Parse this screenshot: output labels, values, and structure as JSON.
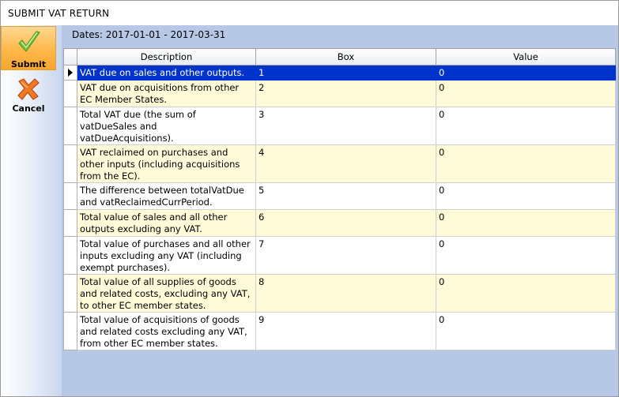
{
  "window": {
    "title": "SUBMIT VAT RETURN"
  },
  "sidebar": {
    "submit_label": "Submit",
    "cancel_label": "Cancel",
    "submit_icon": "checkmark-icon",
    "cancel_icon": "x-icon"
  },
  "header": {
    "dates": "Dates: 2017-01-01 - 2017-03-31"
  },
  "grid": {
    "columns": [
      "Description",
      "Box",
      "Value"
    ],
    "rows": [
      {
        "description": "VAT due on sales and other outputs.",
        "box": "1",
        "value": "0"
      },
      {
        "description": "VAT due on acquisitions from other EC Member States.",
        "box": "2",
        "value": "0"
      },
      {
        "description": "Total VAT due (the sum of vatDueSales and vatDueAcquisitions).",
        "box": "3",
        "value": "0"
      },
      {
        "description": "VAT reclaimed on purchases and other inputs (including acquisitions from the EC).",
        "box": "4",
        "value": "0"
      },
      {
        "description": "The difference between totalVatDue and vatReclaimedCurrPeriod.",
        "box": "5",
        "value": "0"
      },
      {
        "description": "Total value of sales and all other outputs excluding any VAT.",
        "box": "6",
        "value": "0"
      },
      {
        "description": "Total value of purchases and all other inputs excluding any VAT (including exempt purchases).",
        "box": "7",
        "value": "0"
      },
      {
        "description": "Total value of all supplies of goods and related costs, excluding any VAT, to other EC member states.",
        "box": "8",
        "value": "0"
      },
      {
        "description": "Total value of acquisitions of goods and related costs excluding any VAT, from other EC member states.",
        "box": "9",
        "value": "0"
      }
    ]
  },
  "colors": {
    "selected_row": "#0033cc",
    "alt_row": "#fffbd9",
    "panel_bg": "#b7c8e6",
    "submit_bg": "#ffb84a"
  }
}
